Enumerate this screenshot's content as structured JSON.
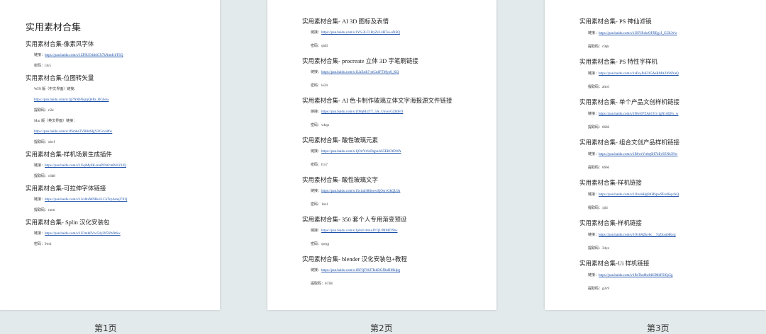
{
  "pages": [
    {
      "label": "第1页",
      "title": "实用素材合集",
      "sections": [
        {
          "heading": "实用素材合集-像素风字体",
          "rows": [
            {
              "label": "链接：",
              "link": "https://pan.baidu.com/s/1ZF8UO4thiCX7kNmtfchTSQ"
            },
            {
              "label": "密码：l3y5",
              "link": ""
            }
          ]
        },
        {
          "heading": "实用素材合集-位图转矢量",
          "rows": [
            {
              "label": "WIN 版（中文界面）链接：",
              "link": ""
            },
            {
              "label": "",
              "link": "https://pan.baidu.com/s/1jj7NNbNqzqQhPa_RGhow"
            },
            {
              "label": "提取码：ri2z",
              "link": ""
            },
            {
              "label": "Mac 版（英文界面）链接：",
              "link": ""
            },
            {
              "label": "",
              "link": "https://pan.baidu.com/s/1fSmbaTVB0dSIgYZGcvs8fw"
            },
            {
              "label": "提取码：obvf",
              "link": ""
            }
          ]
        },
        {
          "heading": "实用素材合集-样机场景生成插件",
          "rows": [
            {
              "label": "链接：",
              "link": "https://pan.baidu.com/s/1UqiMy8K-muPOWcmPd1Z1IQ"
            },
            {
              "label": "提取码：c6d8",
              "link": ""
            }
          ]
        },
        {
          "heading": "实用素材合集-可拉伸字体链接",
          "rows": [
            {
              "label": "链接：",
              "link": "https://pan.baidu.com/s/12cdbxMNBu1LCkTcpAmqVXQ"
            },
            {
              "label": "提取码：ruon",
              "link": ""
            }
          ]
        },
        {
          "heading": "实用素材合集- Splin 汉化安装包",
          "rows": [
            {
              "label": "链接：",
              "link": "https://pan.baidu.com/s/1U3mk6Vnc54yl2f56W0t6w"
            },
            {
              "label": "密码：9wsi",
              "link": ""
            }
          ]
        }
      ]
    },
    {
      "label": "第2页",
      "title": "",
      "sections": [
        {
          "heading": "实用素材合集- AI 3D 图标及表情",
          "rows": [
            {
              "label": "链接：",
              "link": "https://pan.baidu.com/s/1Y6-3LC1ByZvL4H7ss-uNSQ"
            },
            {
              "label": "密码：qid4",
              "link": ""
            }
          ]
        },
        {
          "heading": "实用素材合集- procreate 立体 3D 字笔刷链接",
          "rows": [
            {
              "label": "链接：",
              "link": "https://pan.baidu.com/s/1UaEsik7-ntCn4FTMyo0_KQ"
            },
            {
              "label": "密码：lo24",
              "link": ""
            }
          ]
        },
        {
          "heading": "实用素材合集- AI 色卡制作玻璃立体文字海报源文件链接",
          "rows": [
            {
              "label": "链接：",
              "link": "https://pan.baidu.com/s/1O8p8I/zTT_5A_UnvsvGZh0FO"
            },
            {
              "label": "密码：wkqo",
              "link": ""
            }
          ]
        },
        {
          "heading": "实用素材合集- 酸性玻璃元素",
          "rows": [
            {
              "label": "链接：",
              "link": "https://pan.baidu.com/s/1jOrrYr6vDqpuJsS5EKOtDWA"
            },
            {
              "label": "密码：fcx7",
              "link": ""
            }
          ]
        },
        {
          "heading": "实用素材合集- 酸性玻璃文字",
          "rows": [
            {
              "label": "链接：",
              "link": "https://pan.baidu.com/s/15s1ab38tbwwiQOsrvGkQUiA"
            },
            {
              "label": "密码：1nxl",
              "link": ""
            }
          ]
        },
        {
          "heading": "实用素材合集- 350 套个人专用渐变预设",
          "rows": [
            {
              "label": "链接：",
              "link": "https://pan.baidu.com/s/1plnVv8d-uJYQLfMMZJ9tw"
            },
            {
              "label": "密码：qwgg",
              "link": ""
            }
          ]
        },
        {
          "heading": "实用素材合集- blender 汉化安装包+教程",
          "rows": [
            {
              "label": "链接：",
              "link": "https://pan.baidu.com/s/1RFQF96J7IkkDGfBnHMkIpg"
            },
            {
              "label": "提取码：673B",
              "link": ""
            }
          ]
        }
      ]
    },
    {
      "label": "第3页",
      "title": "",
      "sections": [
        {
          "heading": "实用素材合集- PS 神仙滤镜",
          "rows": [
            {
              "label": "链接：",
              "link": "https://pan.baidu.com/s/13HYRckrOFfiEg1J_GI3LWw"
            },
            {
              "label": "提取码：c9pk",
              "link": ""
            }
          ]
        },
        {
          "heading": "实用素材合集- PS 特性字样机",
          "rows": [
            {
              "label": "链接：",
              "link": "https://pan.baidu.com/s/1zDq-PuFJ65AeRMAZt6NXaQ"
            },
            {
              "label": "提取码：altcd",
              "link": ""
            }
          ]
        },
        {
          "heading": "实用素材合集- 单个产品文创样机链接",
          "rows": [
            {
              "label": "链接：",
              "link": "https://pan.baidu.com/s/198vt07ZAb1Y1-1gN1dQFx_w"
            },
            {
              "label": "提取码：6666",
              "link": ""
            }
          ]
        },
        {
          "heading": "实用素材合集- 组合文创产品样机链接",
          "rows": [
            {
              "label": "链接：",
              "link": "https://pan.baidu.com/s/1R0wrYrtbq6H7bEv9ZNh3Nw"
            },
            {
              "label": "提取码：6666",
              "link": ""
            }
          ]
        },
        {
          "heading": "实用素材合集-样机链接",
          "rows": [
            {
              "label": "链接：",
              "link": "https://pan.baidu.com/s/12hxdsHgB4HSpw9Fu4KqvAQ"
            },
            {
              "label": "提取码：xji4",
              "link": ""
            }
          ]
        },
        {
          "heading": "实用素材合集-样机链接",
          "rows": [
            {
              "label": "链接：",
              "link": "https://pan.baidu.com/s/1Ov8AZkv8c__7qZbxu6lKvg"
            },
            {
              "label": "提取码：34yo",
              "link": ""
            }
          ]
        },
        {
          "heading": "实用素材合集-Ui 样机链接",
          "rows": [
            {
              "label": "链接：",
              "link": "https://pan.baidu.com/s/1RrTkn8heId63MhFSlQs5g"
            },
            {
              "label": "提取码：g3v9",
              "link": ""
            }
          ]
        }
      ]
    }
  ]
}
